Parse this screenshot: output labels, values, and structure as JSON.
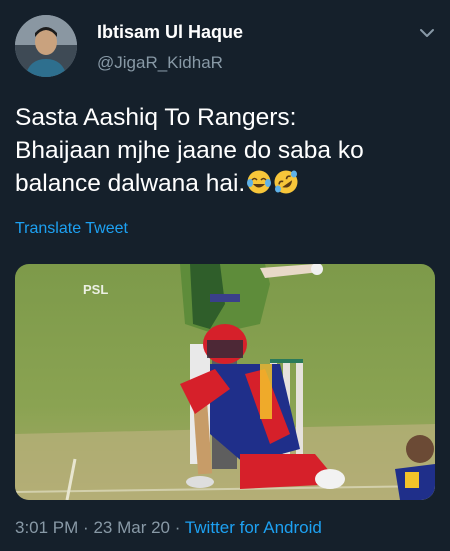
{
  "author": {
    "display_name": "Ibtisam Ul Haque",
    "handle": "@JigaR_KidhaR"
  },
  "tweet": {
    "text_lines": [
      "Sasta Aashiq To Rangers:",
      "Bhaijaan mjhe jaane do saba ko",
      "balance dalwana hai."
    ],
    "emojis": [
      "face-with-tears-of-joy",
      "rolling-on-the-floor-laughing"
    ],
    "translate_label": "Translate Tweet"
  },
  "media": {
    "watermark": "PSL"
  },
  "meta": {
    "time": "3:01 PM",
    "separator": "·",
    "date": "23 Mar 20",
    "source": "Twitter for Android"
  },
  "colors": {
    "background": "#15202b",
    "primary_text": "#ffffff",
    "secondary_text": "#8899a6",
    "accent": "#1da1f2"
  }
}
